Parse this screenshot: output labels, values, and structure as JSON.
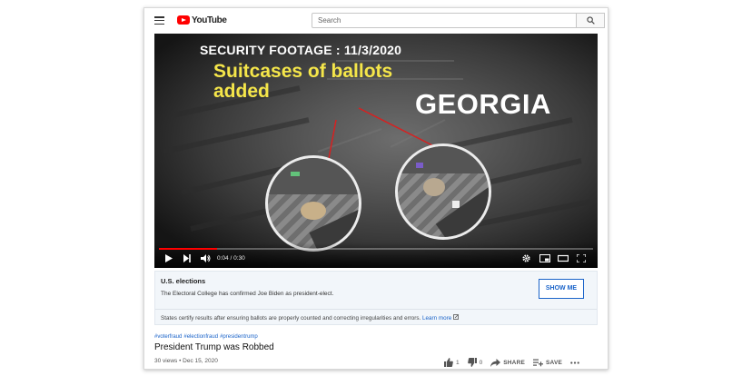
{
  "header": {
    "logo_text": "YouTube",
    "search_placeholder": "Search"
  },
  "video": {
    "overlay_title": "SECURITY FOOTAGE : 11/3/2020",
    "overlay_caption_line1": "Suitcases of ballots",
    "overlay_caption_line2": "added",
    "overlay_state": "GEORGIA",
    "time_display": "0:04 / 0:30",
    "progress_fraction": 0.133
  },
  "info_panel": {
    "title": "U.S. elections",
    "text": "The Electoral College has confirmed Joe Biden as president-elect.",
    "button_label": "SHOW ME",
    "sub_text": "States certify results after ensuring ballots are properly counted and correcting irregularities and errors.",
    "learn_more": "Learn more"
  },
  "details": {
    "tags": [
      "#voterfraud",
      "#electionfraud",
      "#presidentrump"
    ],
    "title": "President Trump was Robbed",
    "meta": "30 views • Dec 15, 2020",
    "likes": "1",
    "dislikes": "0",
    "share_label": "SHARE",
    "save_label": "SAVE"
  },
  "colors": {
    "accent_red": "#ff0000",
    "link_blue": "#1a63c9",
    "caption_yellow": "#f5e64a"
  }
}
